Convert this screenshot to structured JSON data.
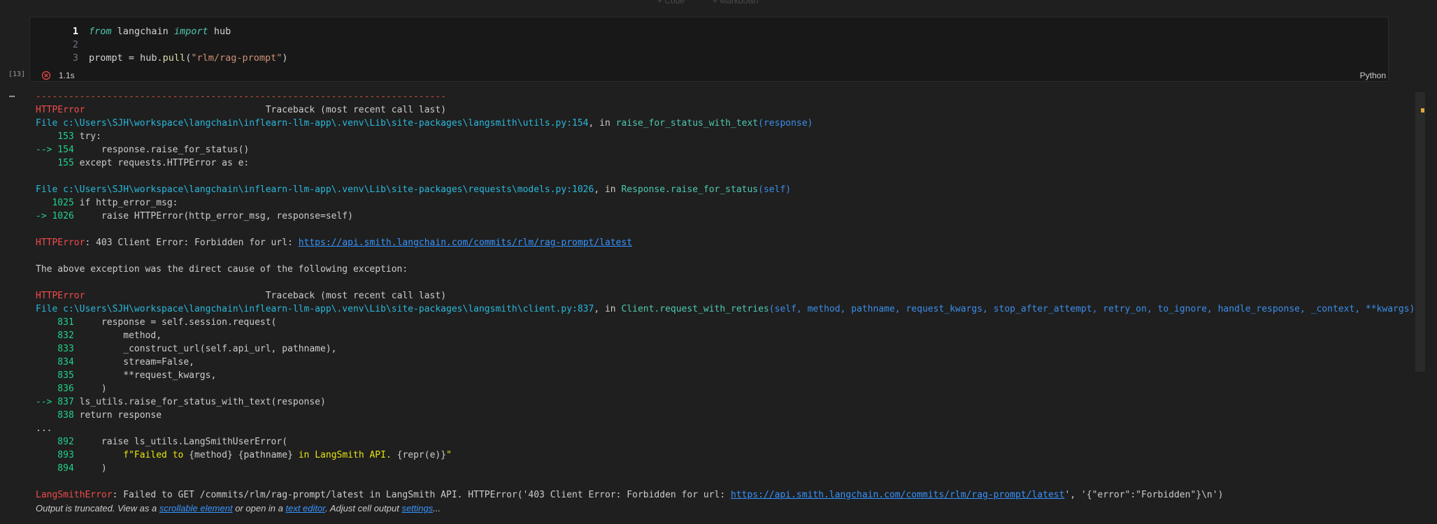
{
  "toolbar": {
    "add_code": "+ Code",
    "add_markdown": "+ Markdown"
  },
  "cell": {
    "exec_count": "[13]",
    "duration": "1.1s",
    "language": "Python",
    "lines": {
      "l1_num": "1",
      "l1_kw1": "from",
      "l1_mod": " langchain ",
      "l1_kw2": "import",
      "l1_rest": " hub",
      "l2_num": "2",
      "l3_num": "3",
      "l3_a": "prompt = hub.",
      "l3_fn": "pull",
      "l3_b": "(",
      "l3_str": "\"rlm/rag-prompt\"",
      "l3_c": ")"
    }
  },
  "output": {
    "menu": "…",
    "dashes": "---------------------------------------------------------------------------",
    "tb1_name": "HTTPError",
    "tb1_pad": "                                 ",
    "tb1_title": "Traceback (most recent call last)",
    "f1_prefix": "File ",
    "f1_path": "c:\\Users\\SJH\\workspace\\langchain\\inflearn-llm-app\\.venv\\Lib\\site-packages\\langsmith\\utils.py:154",
    "f1_in": ", in ",
    "f1_func": "raise_for_status_with_text",
    "f1_args": "(response)",
    "a153_n": "    153",
    "a153_c": " try:",
    "a154_n": "--> 154",
    "a154_c": "     response.raise_for_status()",
    "a155_n": "    155",
    "a155_c": " except requests.HTTPError as e:",
    "f2_prefix": "File ",
    "f2_path": "c:\\Users\\SJH\\workspace\\langchain\\inflearn-llm-app\\.venv\\Lib\\site-packages\\requests\\models.py:1026",
    "f2_in": ", in ",
    "f2_func": "Response.raise_for_status",
    "f2_args": "(self)",
    "b1025_n": "   1025",
    "b1025_c": " if http_error_msg:",
    "b1026_n": "-> 1026",
    "b1026_c": "     raise HTTPError(http_error_msg, response=self)",
    "e1_name": "HTTPError",
    "e1_msg": ": 403 Client Error: Forbidden for url: ",
    "e1_url": "https://api.smith.langchain.com/commits/rlm/rag-prompt/latest",
    "cause": "The above exception was the direct cause of the following exception:",
    "tb2_name": "HTTPError",
    "tb2_pad": "                                 ",
    "tb2_title": "Traceback (most recent call last)",
    "f3_prefix": "File ",
    "f3_path": "c:\\Users\\SJH\\workspace\\langchain\\inflearn-llm-app\\.venv\\Lib\\site-packages\\langsmith\\client.py:837",
    "f3_in": ", in ",
    "f3_func": "Client.request_with_retries",
    "f3_args": "(self, method, pathname, request_kwargs, stop_after_attempt, retry_on, to_ignore, handle_response, _context, **kwargs)",
    "c831_n": "    831",
    "c831_c": "     response = self.session.request(",
    "c832_n": "    832",
    "c832_c": "         method,",
    "c833_n": "    833",
    "c833_c": "         _construct_url(self.api_url, pathname),",
    "c834_n": "    834",
    "c834_c": "         stream=False,",
    "c835_n": "    835",
    "c835_c": "         **request_kwargs,",
    "c836_n": "    836",
    "c836_c": "     )",
    "c837_n": "--> 837",
    "c837_c": " ls_utils.raise_for_status_with_text(response)",
    "c838_n": "    838",
    "c838_c": " return response",
    "ellipsis": "...",
    "d892_n": "    892",
    "d892_c": "     raise ls_utils.LangSmithUserError(",
    "d893_n": "    893",
    "d893_a": "         ",
    "d893_s1": "f\"Failed to ",
    "d893_b1": "{method}",
    "d893_s2": " ",
    "d893_b2": "{pathname}",
    "d893_s3": " in LangSmith API. ",
    "d893_b3": "{repr(e)}",
    "d893_s4": "\"",
    "d894_n": "    894",
    "d894_c": "     )",
    "e2_name": "LangSmithError",
    "e2_msg": ": Failed to GET /commits/rlm/rag-prompt/latest in LangSmith API. HTTPError('403 Client Error: Forbidden for url: ",
    "e2_url": "https://api.smith.langchain.com/commits/rlm/rag-prompt/latest",
    "e2_tail": "', '{\"error\":\"Forbidden\"}\\n')",
    "trunc_a": "Output is truncated. View as a ",
    "trunc_link1": "scrollable element",
    "trunc_b": " or open in a ",
    "trunc_link2": "text editor",
    "trunc_c": ". Adjust cell output ",
    "trunc_link3": "settings",
    "trunc_d": "..."
  }
}
